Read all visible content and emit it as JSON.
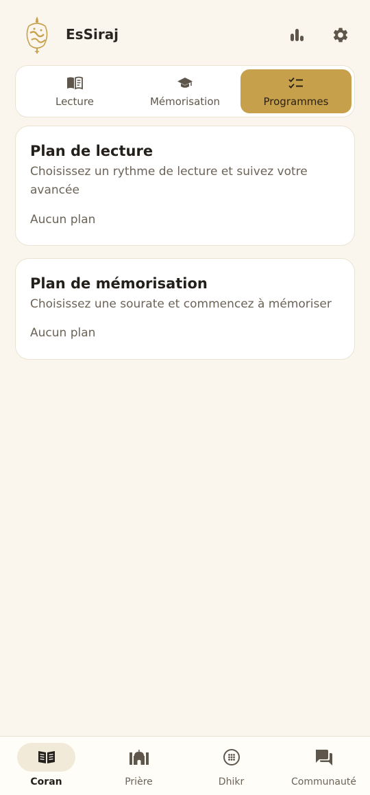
{
  "header": {
    "app_title": "EsSiraj",
    "stats_icon": "bar-chart-icon",
    "settings_icon": "gear-icon"
  },
  "tabs": [
    {
      "label": "Lecture",
      "icon": "open-book-icon",
      "active": false
    },
    {
      "label": "Mémorisation",
      "icon": "graduation-cap-icon",
      "active": false
    },
    {
      "label": "Programmes",
      "icon": "checklist-icon",
      "active": true
    }
  ],
  "cards": [
    {
      "title": "Plan de lecture",
      "description": "Choisissez un rythme de lecture et suivez votre avancée",
      "status": "Aucun plan"
    },
    {
      "title": "Plan de mémorisation",
      "description": "Choisissez une sourate et commencez à mémoriser",
      "status": "Aucun plan"
    }
  ],
  "bottom_nav": [
    {
      "label": "Coran",
      "icon": "quran-book-icon",
      "active": true
    },
    {
      "label": "Prière",
      "icon": "mosque-icon",
      "active": false
    },
    {
      "label": "Dhikr",
      "icon": "tasbih-icon",
      "active": false
    },
    {
      "label": "Communauté",
      "icon": "chat-bubbles-icon",
      "active": false
    }
  ],
  "colors": {
    "background": "#faf6ee",
    "accent": "#c7a04b",
    "text": "#2a2520",
    "muted": "#6b6357"
  }
}
